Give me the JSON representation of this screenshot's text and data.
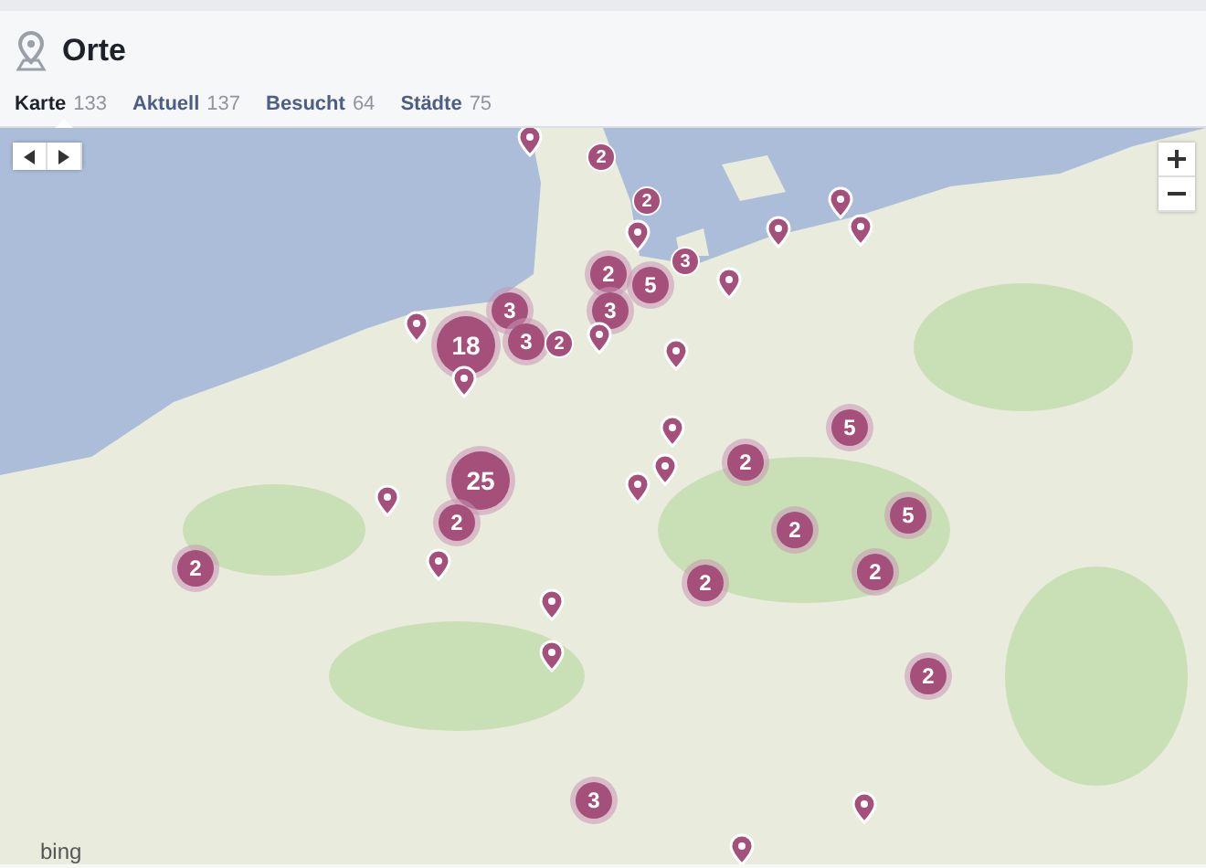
{
  "header": {
    "title": "Orte"
  },
  "tabs": [
    {
      "label": "Karte",
      "count": "133",
      "selected": true
    },
    {
      "label": "Aktuell",
      "count": "137",
      "selected": false
    },
    {
      "label": "Besucht",
      "count": "64",
      "selected": false
    },
    {
      "label": "Städte",
      "count": "75",
      "selected": false
    }
  ],
  "map": {
    "attribution": "bing",
    "markers": [
      {
        "kind": "pin"
      },
      {
        "kind": "numbered-pin",
        "count": "2"
      },
      {
        "kind": "numbered-pin",
        "count": "2"
      },
      {
        "kind": "pin"
      },
      {
        "kind": "pin"
      },
      {
        "kind": "pin"
      },
      {
        "kind": "pin"
      },
      {
        "kind": "numbered-pin",
        "count": "3"
      },
      {
        "kind": "cluster",
        "count": "2"
      },
      {
        "kind": "cluster",
        "count": "5"
      },
      {
        "kind": "pin"
      },
      {
        "kind": "cluster",
        "count": "3"
      },
      {
        "kind": "cluster",
        "count": "3"
      },
      {
        "kind": "pin"
      },
      {
        "kind": "cluster",
        "count": "18"
      },
      {
        "kind": "cluster",
        "count": "3"
      },
      {
        "kind": "numbered-pin",
        "count": "2"
      },
      {
        "kind": "pin"
      },
      {
        "kind": "pin"
      },
      {
        "kind": "pin"
      },
      {
        "kind": "cluster",
        "count": "5"
      },
      {
        "kind": "pin"
      },
      {
        "kind": "cluster",
        "count": "2"
      },
      {
        "kind": "pin"
      },
      {
        "kind": "cluster",
        "count": "25"
      },
      {
        "kind": "pin"
      },
      {
        "kind": "pin"
      },
      {
        "kind": "cluster",
        "count": "2"
      },
      {
        "kind": "cluster",
        "count": "2"
      },
      {
        "kind": "cluster",
        "count": "5"
      },
      {
        "kind": "cluster",
        "count": "2"
      },
      {
        "kind": "pin"
      },
      {
        "kind": "cluster",
        "count": "2"
      },
      {
        "kind": "cluster",
        "count": "2"
      },
      {
        "kind": "pin"
      },
      {
        "kind": "pin"
      },
      {
        "kind": "cluster",
        "count": "2"
      },
      {
        "kind": "cluster",
        "count": "3"
      },
      {
        "kind": "pin"
      },
      {
        "kind": "pin"
      }
    ]
  }
}
